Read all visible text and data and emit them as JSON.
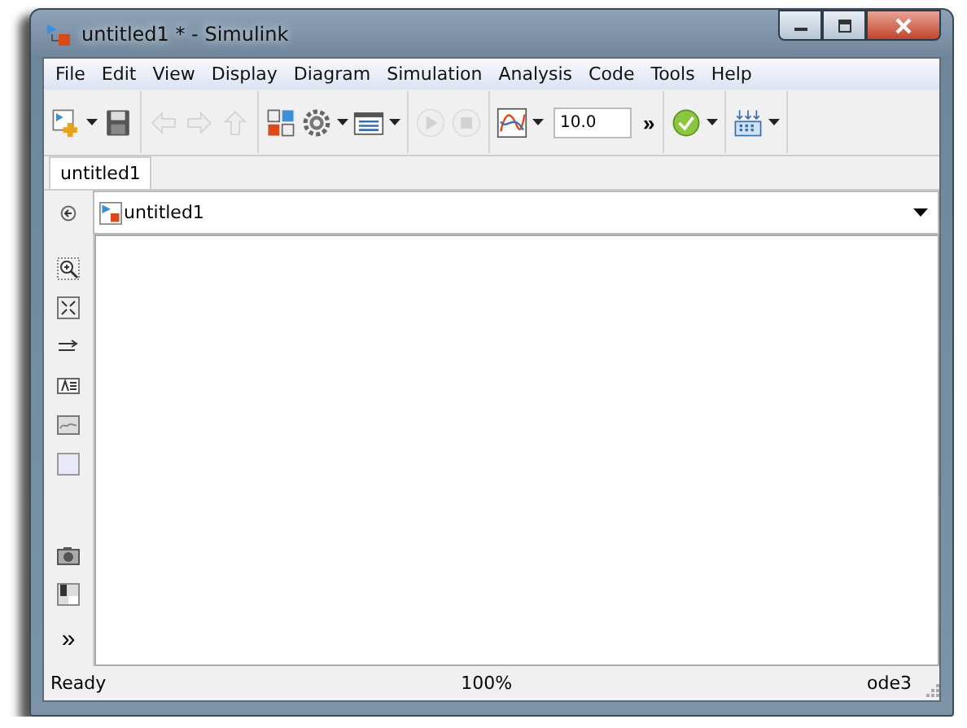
{
  "window": {
    "title": "untitled1 * - Simulink"
  },
  "menu": [
    "File",
    "Edit",
    "View",
    "Display",
    "Diagram",
    "Simulation",
    "Analysis",
    "Code",
    "Tools",
    "Help"
  ],
  "toolbar": {
    "groups": [
      [
        {
          "disabled": false,
          "dropdown": true
        },
        {
          "disabled": false,
          "dropdown": false
        }
      ],
      [
        {
          "disabled": true,
          "dropdown": false
        },
        {
          "disabled": true,
          "dropdown": false
        },
        {
          "disabled": true,
          "dropdown": false
        }
      ],
      [
        {
          "disabled": false,
          "dropdown": false
        },
        {
          "disabled": false,
          "dropdown": true
        },
        {
          "disabled": false,
          "dropdown": true
        }
      ],
      [
        {
          "disabled": true,
          "dropdown": false
        },
        {
          "disabled": true,
          "dropdown": false
        }
      ],
      [
        {
          "disabled": false,
          "dropdown": true
        }
      ]
    ],
    "stop_time": "10.0",
    "overflow": "»",
    "tail": [
      {
        "disabled": false,
        "dropdown": true
      },
      {
        "disabled": false,
        "dropdown": true
      }
    ]
  },
  "tabs": [
    {
      "label": "untitled1",
      "selected": true
    }
  ],
  "breadcrumb": "untitled1",
  "palette_more": "»",
  "status_bar": {
    "left": "Ready",
    "center": "100%",
    "right": "ode3"
  }
}
